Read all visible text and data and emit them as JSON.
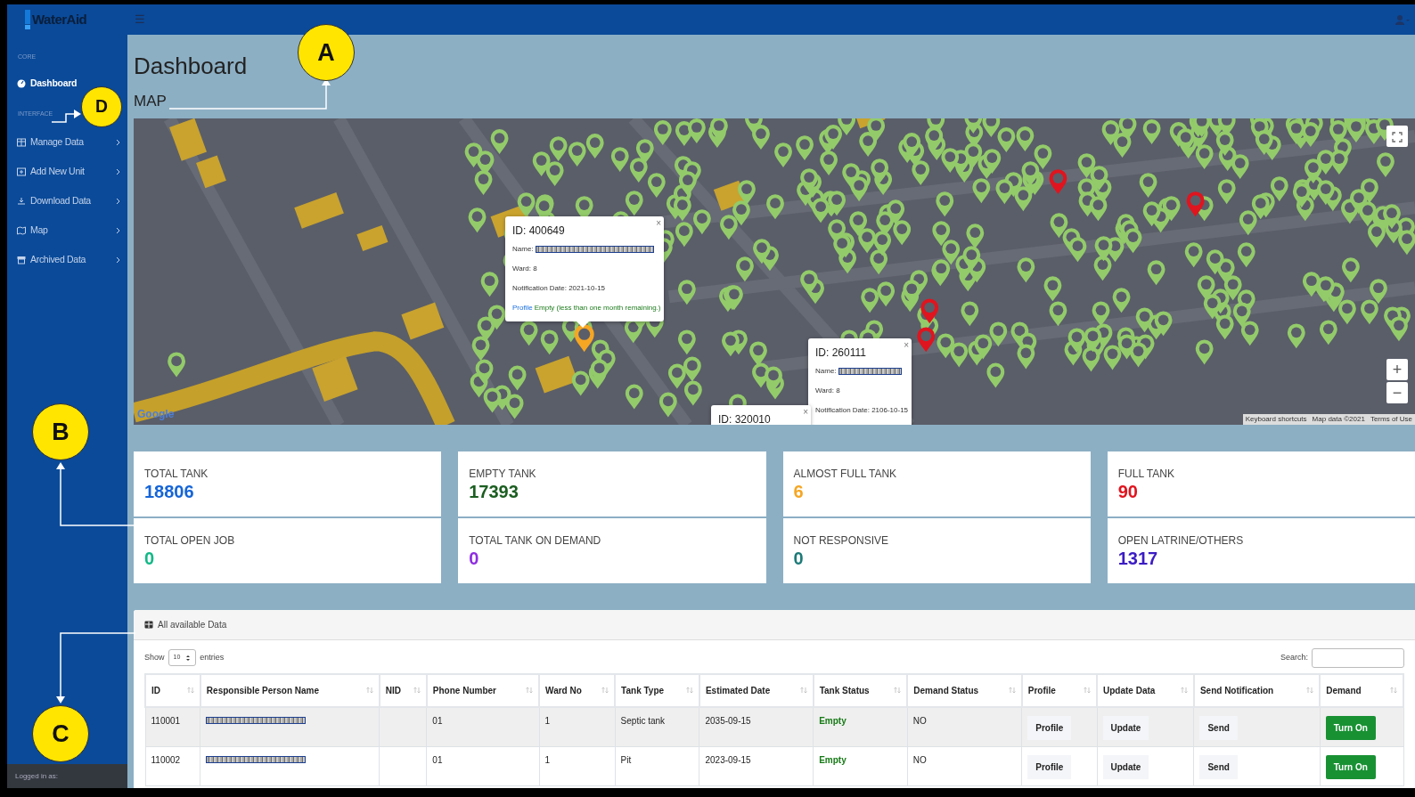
{
  "topbar": {
    "logo": "WaterAid",
    "menu_toggle": "☰"
  },
  "sidebar": {
    "sections": [
      {
        "heading": "CORE",
        "items": [
          {
            "label": "Dashboard",
            "selected": true,
            "expandable": false
          }
        ]
      },
      {
        "heading": "INTERFACE",
        "items": [
          {
            "label": "Manage Data",
            "selected": false,
            "expandable": true
          },
          {
            "label": "Add New Unit",
            "selected": false,
            "expandable": true
          },
          {
            "label": "Download Data",
            "selected": false,
            "expandable": true
          },
          {
            "label": "Map",
            "selected": false,
            "expandable": true
          },
          {
            "label": "Archived Data",
            "selected": false,
            "expandable": true
          }
        ]
      }
    ],
    "footer": "Logged in as:"
  },
  "page": {
    "title": "Dashboard",
    "map_heading": "MAP"
  },
  "map": {
    "popups": [
      {
        "id_text": "ID: 400649",
        "name_label": "Name:",
        "name_redacted": true,
        "ward": "Ward: 8",
        "notification": "Notification Date: 2021-10-15",
        "link": "Profile",
        "status": "Empty (less than one month remaining.)",
        "close": "×"
      },
      {
        "id_text": "ID: 260111",
        "name_label": "Name:",
        "name_redacted": true,
        "ward": "Ward: 8",
        "notification": "Notification Date: 2106-10-15",
        "close": "×"
      },
      {
        "id_text": "ID: 320010",
        "close": "×"
      }
    ],
    "zoom_in": "+",
    "zoom_out": "−",
    "logo": "Google",
    "attribution": [
      "Keyboard shortcuts",
      "Map data ©2021",
      "Terms of Use"
    ]
  },
  "stats": [
    {
      "label": "TOTAL TANK",
      "value": "18806",
      "color": "#1565d8"
    },
    {
      "label": "EMPTY TANK",
      "value": "17393",
      "color": "#1b5e20"
    },
    {
      "label": "ALMOST FULL TANK",
      "value": "6",
      "color": "#f5a623"
    },
    {
      "label": "FULL TANK",
      "value": "90",
      "color": "#e0141e"
    },
    {
      "label": "TOTAL OPEN JOB",
      "value": "0",
      "color": "#12b886"
    },
    {
      "label": "TOTAL TANK ON DEMAND",
      "value": "0",
      "color": "#8e2de2"
    },
    {
      "label": "NOT RESPONSIVE",
      "value": "0",
      "color": "#1d7a78"
    },
    {
      "label": "OPEN LATRINE/OTHERS",
      "value": "1317",
      "color": "#3b1cc4"
    }
  ],
  "table": {
    "title": "All available Data",
    "show_label": "Show",
    "page_size": "10",
    "entries_label": "entries",
    "search_label": "Search:",
    "columns": [
      "ID",
      "Responsible Person Name",
      "NID",
      "Phone Number",
      "Ward No",
      "Tank Type",
      "Estimated Date",
      "Tank Status",
      "Demand Status",
      "Profile",
      "Update Data",
      "Send Notification",
      "Demand"
    ],
    "rows": [
      {
        "id": "110001",
        "name_redacted": true,
        "phone": "01",
        "ward": "1",
        "tank_type": "Septic tank",
        "estimated_date": "2035-09-15",
        "tank_status": "Empty",
        "demand_status": "NO",
        "profile": "Profile",
        "update": "Update",
        "send": "Send",
        "demand": "Turn On"
      },
      {
        "id": "110002",
        "name_redacted": true,
        "phone": "01",
        "ward": "1",
        "tank_type": "Pit",
        "estimated_date": "2023-09-15",
        "tank_status": "Empty",
        "demand_status": "NO",
        "profile": "Profile",
        "update": "Update",
        "send": "Send",
        "demand": "Turn On"
      }
    ]
  },
  "annotations": [
    {
      "label": "A"
    },
    {
      "label": "D"
    },
    {
      "label": "B"
    },
    {
      "label": "C"
    }
  ]
}
